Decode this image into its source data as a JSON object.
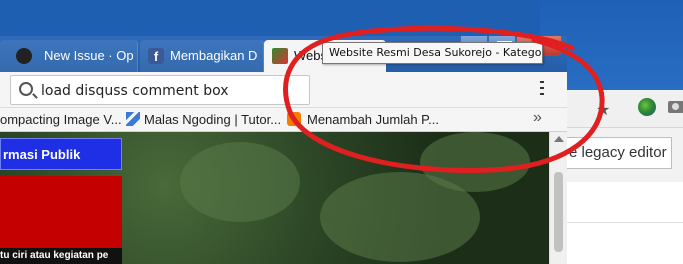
{
  "browser": {
    "tabs": [
      {
        "label": "New Issue · Op",
        "icon": "github-icon"
      },
      {
        "label": "Membagikan D",
        "icon": "facebook-icon",
        "icon_glyph": "f"
      },
      {
        "label": "Website Resm",
        "icon": "site-favicon-icon",
        "close": "✕"
      }
    ],
    "new_tab_label": "+",
    "url_value": "load disquss comment box",
    "tooltip": "Website Resmi Desa Sukorejo - Kategori",
    "bookmarks": [
      {
        "label": "ompacting Image V..."
      },
      {
        "label": "Malas Ngoding | Tutor...",
        "icon": "wordpress-icon"
      },
      {
        "label": "Menambah Jumlah P...",
        "icon": "blogger-icon"
      }
    ],
    "bookmarks_more": "»"
  },
  "page": {
    "sidebar_heading": "rmasi Publik",
    "caption": "tu ciri atau kegiatan pe"
  },
  "background_window": {
    "legacy_button": "e legacy editor"
  },
  "colors": {
    "annotation": "#e02020",
    "sidebar_heading_bg": "#1e2fe6",
    "sidebar_block": "#c40000",
    "tab_strip": "#245ea8"
  }
}
